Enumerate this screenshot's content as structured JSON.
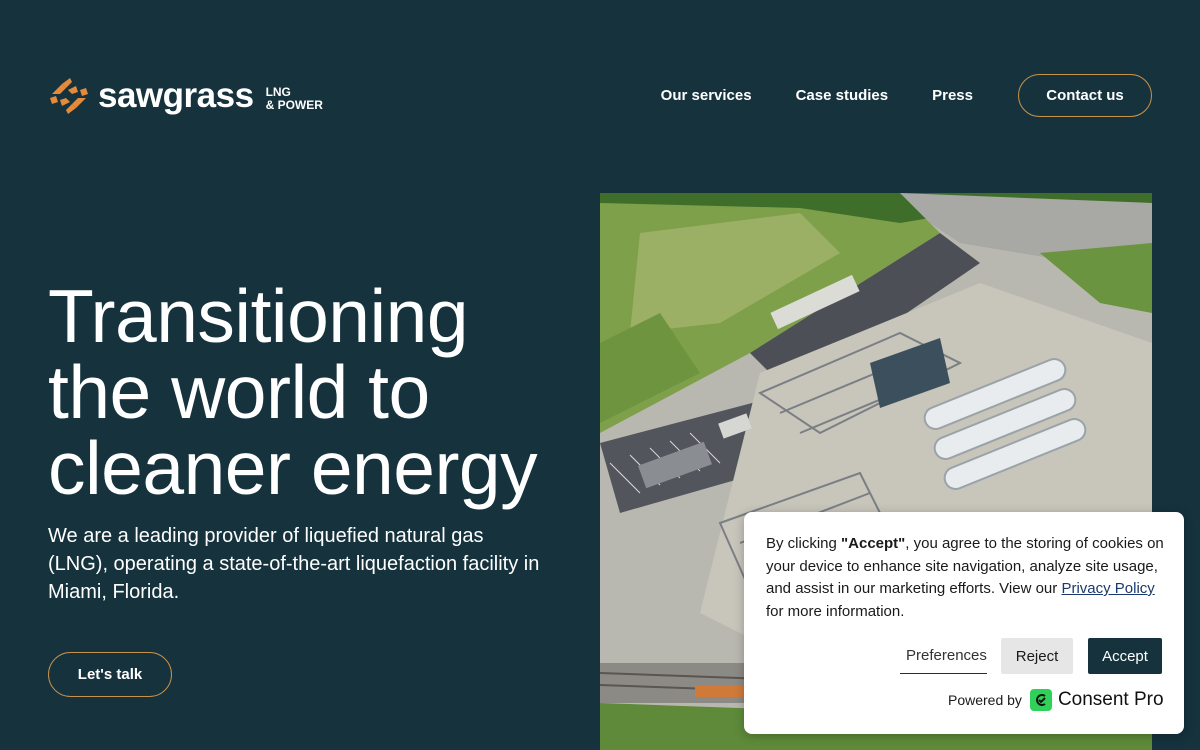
{
  "brand": {
    "name": "sawgrass",
    "tag_line1": "LNG",
    "tag_line2": "& POWER",
    "accent": "#e58a3a"
  },
  "nav": {
    "items": [
      "Our services",
      "Case studies",
      "Press"
    ],
    "contact_label": "Contact us"
  },
  "hero": {
    "title_lines": [
      "Transitioning",
      "the world to",
      "cleaner energy"
    ],
    "description": "We are a leading provider of liquefied natural gas (LNG), operating a state-of-the-art liquefaction facility in Miami, Florida.",
    "cta_label": "Let's talk",
    "image_icon": "aerial-lng-facility-photo"
  },
  "cookie": {
    "text_before": "By clicking ",
    "text_bold": "\"Accept\"",
    "text_middle": ", you agree to the storing of cookies on your device to enhance site navigation, analyze site usage, and assist in our marketing efforts. View our ",
    "privacy_link": "Privacy Policy",
    "text_after": " for more information.",
    "preferences_label": "Preferences",
    "reject_label": "Reject",
    "accept_label": "Accept",
    "powered_by": "Powered by",
    "provider_name": "Consent Pro"
  },
  "colors": {
    "background": "#15323d",
    "button_border": "#c9924a",
    "accept_bg": "#15323d",
    "consent_green": "#2fd158"
  }
}
